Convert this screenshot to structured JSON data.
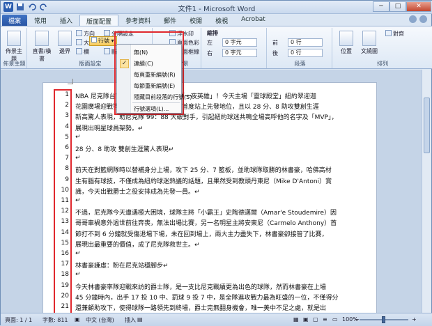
{
  "window": {
    "title": "文件1 - Microsoft Word",
    "logo": "W",
    "buttons": [
      "─",
      "□",
      "✕"
    ]
  },
  "tabs": [
    {
      "label": "檔案"
    },
    {
      "label": "常用"
    },
    {
      "label": "插入"
    },
    {
      "label": "版面配置"
    },
    {
      "label": "參考資料"
    },
    {
      "label": "郵件"
    },
    {
      "label": "校閱"
    },
    {
      "label": "檢視"
    },
    {
      "label": "Acrobat"
    }
  ],
  "ribbon": {
    "theme_group": {
      "label": "佈景主題",
      "btn": "佈景主題"
    },
    "setup_group": {
      "label": "版面設定",
      "direction": "直書/橫書",
      "margins": "邊界",
      "orientation": "方向",
      "size": "大小",
      "columns": "欄",
      "breaks": "分隔設定",
      "line_numbers": "行號",
      "hyphenation": "斷字"
    },
    "page_bg_group": {
      "label": "頁面背景",
      "watermark": "浮水印",
      "page_color": "頁面色彩",
      "borders": "頁面框線"
    },
    "indent_group": {
      "label": "縮排",
      "left_label": "左",
      "left": "0 字元",
      "right_label": "右",
      "right": "0 字元"
    },
    "spacing_group": {
      "label": "段落",
      "before_label": "前",
      "before": "0 行",
      "after_label": "後",
      "after": "0 行"
    },
    "arrange_group": {
      "label": "排列",
      "position": "位置",
      "wrap": "文繞圖",
      "align": "對齊"
    }
  },
  "menu": {
    "items": [
      {
        "label": "無(N)"
      },
      {
        "label": "連續(C)"
      },
      {
        "label": "每頁重新編號(R)"
      },
      {
        "label": "每節重新編號(E)"
      },
      {
        "label": "隱藏目前段落的行號(S)"
      },
      {
        "label": "行號選項(L)..."
      }
    ],
    "checkmark": "✓"
  },
  "document": {
    "lines": [
      {
        "n": "1",
        "text": "NBA 尼克隊台裔後衛林書豪再度上演「一夜英雄」！今天主場「靈球殿堂」紐約翠迎迦"
      },
      {
        "n": "2",
        "text": "花園廣場迎戰猶他爵士隊，林書豪生涯首度站上先發地位，且以 28 分、8 助攻雙創生涯"
      },
      {
        "n": "3",
        "text": "新高驚人表現，助尼克隊 99：88 大破對手，引起紐約球迷共鳴全場高呼他的名字及「MVP」，"
      },
      {
        "n": "4",
        "text": "展現出明星球員架勢。↵"
      },
      {
        "n": "5",
        "text": "↵"
      },
      {
        "n": "6",
        "text": "28 分、8 助攻  雙創生涯驚人表現↵"
      },
      {
        "n": "7",
        "text": "↵"
      },
      {
        "n": "8",
        "text": "前天在對籃網隊時以替補身分上場，攻下 25 分、7 籃板，並助球隊取勝的林書豪，哈佛高材"
      },
      {
        "n": "9",
        "text": "生有腦有球技，不僅成為紐約球迷熱議的話題，且果然受到教頭丹東尼（Mike D'Antoni）賞"
      },
      {
        "n": "10",
        "text": "識，今天出戰爵士之役安排成為先發一員。↵"
      },
      {
        "n": "11",
        "text": "↵"
      },
      {
        "n": "12",
        "text": "不過，尼克隊今天遭遇極大困境，球隊主將「小霸王」史陶德邁爾（Amar'e Stoudemire）因"
      },
      {
        "n": "13",
        "text": "哥哥車禍意外過世前往奔喪，無法出場比賽，另一名明星主將安東尼（Carmelo Anthony）首"
      },
      {
        "n": "14",
        "text": "節打不到 6 分鐘就受傷退場下場，未在回到場上，兩大主力盡失下，林書豪卻接管了比賽，"
      },
      {
        "n": "15",
        "text": "展現出最重要的價值，成了尼克隊救世主。↵"
      },
      {
        "n": "16",
        "text": "↵"
      },
      {
        "n": "17",
        "text": "林書豪謙虛：盼在尼克站穩腳步↵"
      },
      {
        "n": "18",
        "text": "↵"
      },
      {
        "n": "19",
        "text": "今天林書豪率隊迎戰來訪的爵士隊，是一支比尼克戰績更為出色的球隊，然而林書豪在上場"
      },
      {
        "n": "20",
        "text": "45 分鐘時內，出手 17 投 10 中、罰球 9 投 7 中，是全隊進攻戰力最為旺盛的一位，不僅得分"
      },
      {
        "n": "21",
        "text": "還兼顧助攻下，使得球隊一路領先到終場，爵士完無翻身機會，唯一美中不足之處，就是出"
      }
    ]
  },
  "status": {
    "page": "頁面: 1 / 1",
    "words": "字數: 811",
    "language": "中文 (台灣)",
    "mode": "插入",
    "zoom": "100%"
  }
}
